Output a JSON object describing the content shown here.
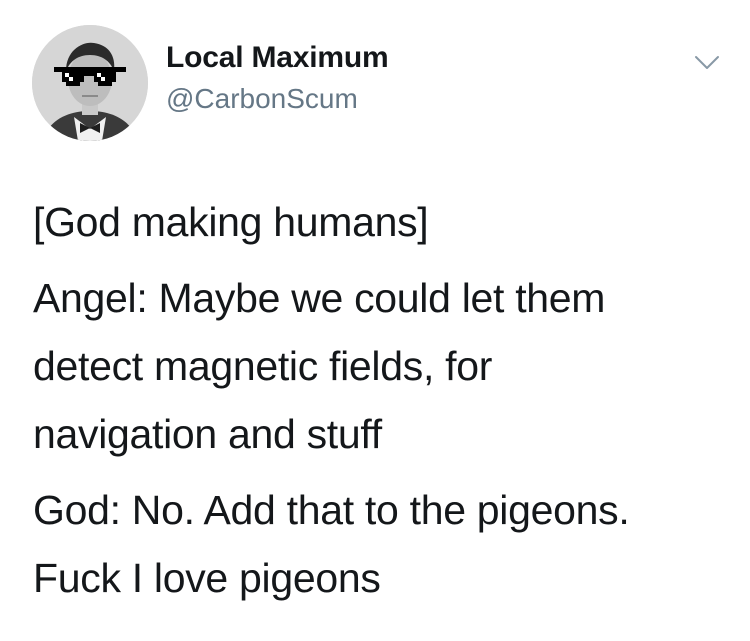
{
  "tweet": {
    "author": {
      "display_name": "Local Maximum",
      "handle": "@CarbonScum",
      "avatar_icon": "profile-avatar-with-pixel-sunglasses"
    },
    "menu_icon": "chevron-down-icon",
    "paragraphs": [
      {
        "lines": [
          "[God making humans]"
        ]
      },
      {
        "lines": [
          "Angel: Maybe we could let them",
          "detect magnetic fields, for",
          "navigation and stuff"
        ]
      },
      {
        "lines": [
          "God: No. Add that to the pigeons.",
          "Fuck I love pigeons"
        ]
      }
    ]
  },
  "colors": {
    "text": "#14171a",
    "secondary": "#657786",
    "chevron": "#8899a6",
    "background": "#ffffff"
  }
}
